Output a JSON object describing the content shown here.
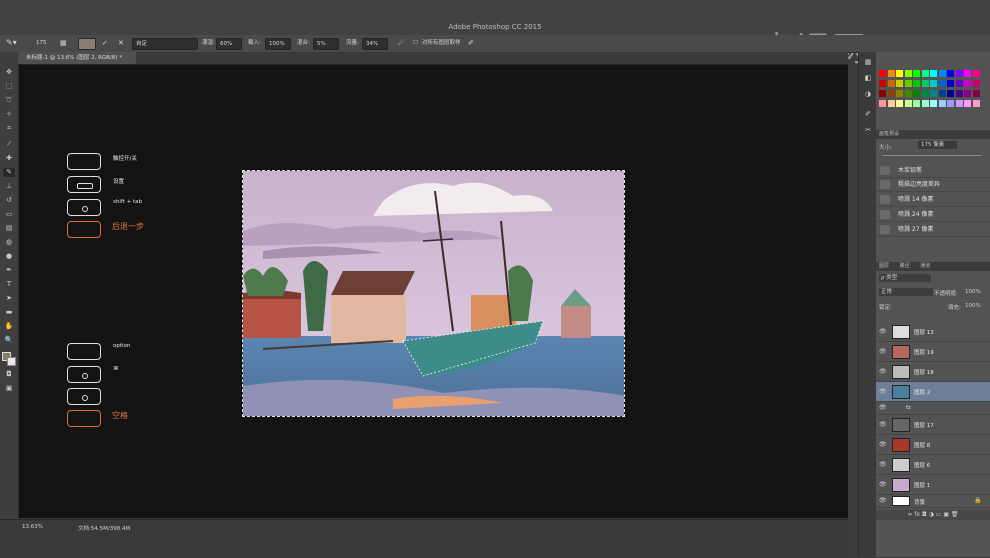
{
  "window": {
    "title": "Adobe Photoshop CC 2015"
  },
  "watermark": "虎课网",
  "options_bar": {
    "brush_size": "175",
    "mode_value": "自定",
    "wetness_label": "潮湿:",
    "wetness_value": "60%",
    "load_label": "载入:",
    "load_value": "100%",
    "mix_label": "混合:",
    "mix_value": "5%",
    "flow_label": "流量:",
    "flow_value": "34%",
    "sample_all_label": "对所有图层取样"
  },
  "document_tab": {
    "label": "未标题-1 @ 13.6% (图层 2, RGB/8) *"
  },
  "shortcut_keys": [
    {
      "caption": "触控开/关"
    },
    {
      "caption": "设置"
    },
    {
      "caption": "shift + tab"
    },
    {
      "caption": "后退一步"
    },
    {
      "caption": "option"
    },
    {
      "caption": "⌘"
    },
    {
      "caption": "空格"
    }
  ],
  "status": {
    "zoom": "13.63%",
    "doc_info": "文档:54.5M/398.4M"
  },
  "swatch_colors": [
    "#ff0000",
    "#ff8800",
    "#ffff00",
    "#88ff00",
    "#00ff00",
    "#00ff88",
    "#00ffff",
    "#0088ff",
    "#0000ff",
    "#8800ff",
    "#ff00ff",
    "#ff0088",
    "#cc0000",
    "#cc6600",
    "#cccc00",
    "#66cc00",
    "#00cc00",
    "#00cc66",
    "#00cccc",
    "#0066cc",
    "#0000cc",
    "#6600cc",
    "#cc00cc",
    "#cc0066",
    "#880000",
    "#884400",
    "#888800",
    "#448800",
    "#008800",
    "#008844",
    "#008888",
    "#004488",
    "#000088",
    "#440088",
    "#880088",
    "#880044",
    "#ff9999",
    "#ffcc99",
    "#ffff99",
    "#ccff99",
    "#99ff99",
    "#99ffcc",
    "#99ffff",
    "#99ccff",
    "#9999ff",
    "#cc99ff",
    "#ff99ff",
    "#ff99cc"
  ],
  "brush_panel": {
    "tab_label": "画笔预设",
    "size_label": "大小:",
    "size_value": "175 像素",
    "presets": [
      {
        "label": "木炭铅笔",
        "num": ""
      },
      {
        "label": "粗描边亮度差异",
        "num": "49"
      },
      {
        "label": "喷溅 14 像素",
        "num": "14"
      },
      {
        "label": "喷溅 24 像素",
        "num": "24"
      },
      {
        "label": "喷溅 27 像素",
        "num": "27"
      }
    ]
  },
  "layers_panel": {
    "tabs": [
      "图层",
      "路径",
      "通道"
    ],
    "kind_label": "ρ 类型",
    "blend_mode": "正常",
    "opacity_label": "不透明度:",
    "opacity_value": "100%",
    "lock_label": "锁定:",
    "fill_label": "填充:",
    "fill_value": "100%",
    "layers": [
      {
        "name": "图层 13"
      },
      {
        "name": "图层 19"
      },
      {
        "name": "图层 18"
      },
      {
        "name": "图层 2"
      },
      {
        "name": "fz"
      },
      {
        "name": "图层 17"
      },
      {
        "name": "图层 8"
      },
      {
        "name": "图层 6"
      },
      {
        "name": "图层 1"
      },
      {
        "name": "背景"
      }
    ]
  }
}
